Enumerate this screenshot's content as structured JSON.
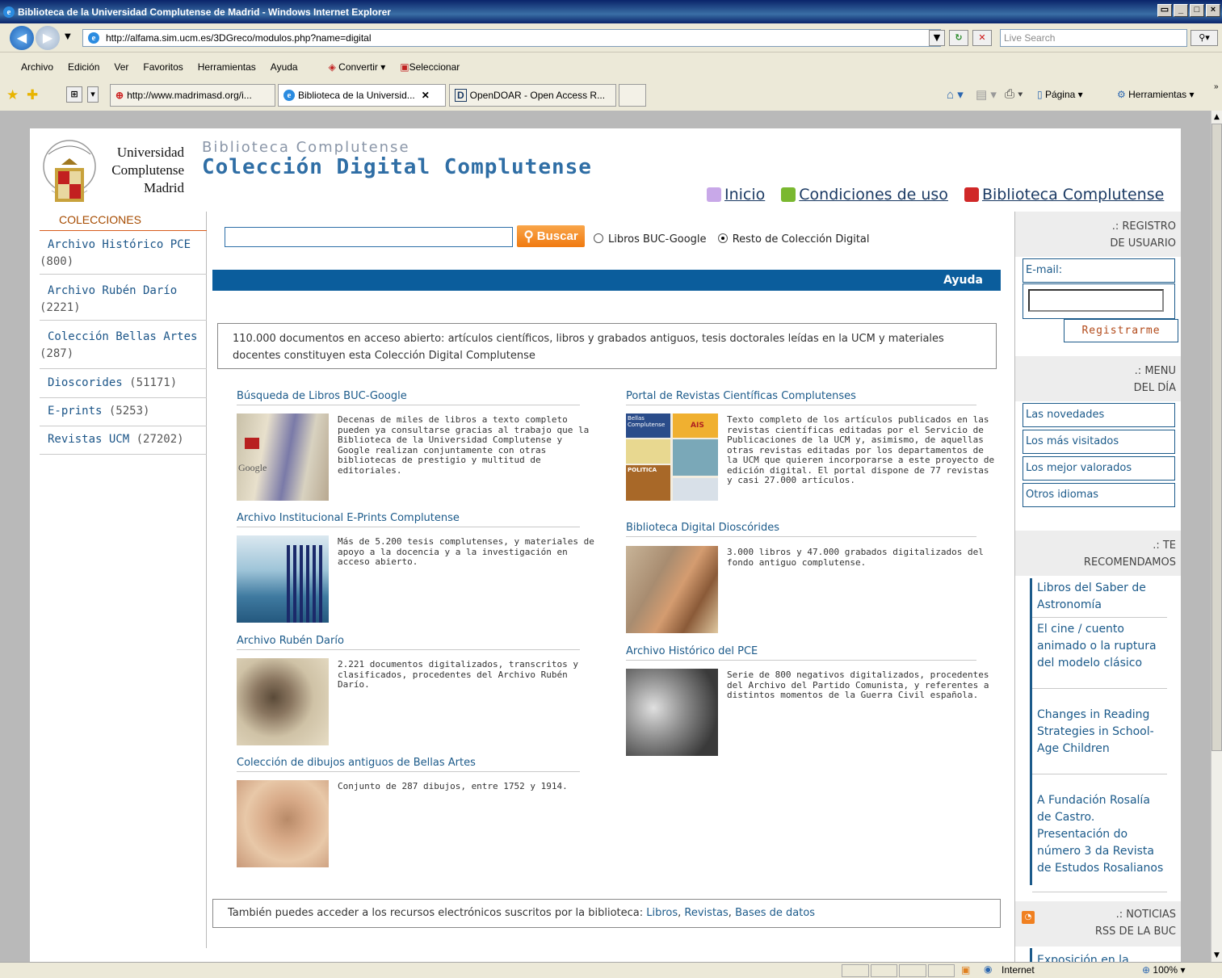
{
  "window": {
    "title": "Biblioteca de la Universidad Complutense de Madrid - Windows Internet Explorer"
  },
  "browser": {
    "url": "http://alfama.sim.ucm.es/3DGreco/modulos.php?name=digital",
    "search_placeholder": "Live Search",
    "menu": [
      "Archivo",
      "Edición",
      "Ver",
      "Favoritos",
      "Herramientas",
      "Ayuda"
    ],
    "convertir_label": "Convertir",
    "seleccionar_label": "Seleccionar",
    "tabs": [
      {
        "label": "http://www.madrimasd.org/i..."
      },
      {
        "label": "Biblioteca de la Universid..."
      },
      {
        "label": "OpenDOAR - Open Access R..."
      }
    ],
    "pagina_label": "Página",
    "herramientas_label": "Herramientas",
    "status": {
      "zone": "Internet",
      "zoom": "100%"
    }
  },
  "header": {
    "logo_lines": [
      "Universidad",
      "Complutense",
      "Madrid"
    ],
    "subtitle": "Biblioteca Complutense",
    "title": "Colección Digital Complutense",
    "links": [
      "Inicio",
      "Condiciones de uso",
      "Biblioteca Complutense"
    ]
  },
  "colecciones": {
    "heading": "COLECCIONES",
    "items": [
      {
        "name": "Archivo Histórico PCE",
        "count": "(800)"
      },
      {
        "name": "Archivo Rubén Darío",
        "count": "(2221)"
      },
      {
        "name": "Colección Bellas Artes",
        "count": "(287)"
      },
      {
        "name": "Dioscorides",
        "count": "(51171)"
      },
      {
        "name": "E-prints",
        "count": "(5253)"
      },
      {
        "name": "Revistas UCM",
        "count": "(27202)"
      }
    ]
  },
  "search": {
    "button": "Buscar",
    "option1": "Libros BUC-Google",
    "option2": "Resto de Colección Digital"
  },
  "help_label": "Ayuda",
  "intro": "110.000 documentos en acceso abierto: artículos científicos, libros y grabados antiguos, tesis doctorales leídas en la UCM y materiales docentes constituyen esta Colección Digital Complutense",
  "sections": [
    {
      "title": "Búsqueda de Libros BUC-Google",
      "desc": "Decenas de miles de libros a texto completo pueden ya consultarse gracias al trabajo que la Biblioteca de la Universidad Complutense y Google realizan conjuntamente con otras bibliotecas de prestigio y multitud de editoriales."
    },
    {
      "title": "Portal de Revistas Científicas Complutenses",
      "desc": "Texto completo de los artículos publicados en las revistas científicas editadas por el Servicio de Publicaciones de la UCM y, asimismo, de aquellas otras revistas editadas por los departamentos de la UCM que quieren incorporarse a este proyecto de edición digital. El portal dispone de 77 revistas y casi 27.000 artículos."
    },
    {
      "title": "Archivo Institucional E-Prints Complutense",
      "desc": "Más de 5.200 tesis complutenses, y materiales de apoyo a la docencia y a la investigación en acceso abierto."
    },
    {
      "title": "Biblioteca Digital Dioscórides",
      "desc": "3.000 libros y 47.000 grabados digitalizados del fondo antiguo complutense."
    },
    {
      "title": "Archivo Rubén Darío",
      "desc": "2.221 documentos digitalizados, transcritos y clasificados, procedentes del Archivo Rubén Darío."
    },
    {
      "title": "Archivo Histórico del PCE",
      "desc": "Serie de 800 negativos digitalizados, procedentes del Archivo del Partido Comunista, y referentes a distintos momentos de la Guerra Civil española."
    },
    {
      "title": "Colección de dibujos antiguos de Bellas Artes",
      "desc": "Conjunto de 287 dibujos, entre 1752 y 1914."
    }
  ],
  "thumb_texts": {
    "google": "Google",
    "revista1": "Bellas Complutense",
    "revista2": "AIS",
    "revista3": "POLITICA"
  },
  "footer": {
    "prefix": "También puedes acceder a los recursos electrónicos suscritos por la biblioteca: ",
    "libros": "Libros",
    "revistas": "Revistas",
    "bases": "Bases de datos",
    "sep": ", "
  },
  "sidebar": {
    "registro_l1": ".: REGISTRO",
    "registro_l2": "DE USUARIO",
    "email_label": "E-mail:",
    "register_button": "Registrarme",
    "menu_l1": ".: MENU",
    "menu_l2": "DEL DÍA",
    "menu_items": [
      "Las novedades",
      "Los más visitados",
      "Los mejor valorados",
      "Otros idiomas"
    ],
    "recom_l1": ".: TE",
    "recom_l2": "RECOMENDAMOS",
    "recommendations": [
      "Libros del Saber de Astronomía",
      "El cine / cuento animado o la ruptura del modelo clásico",
      "Changes in Reading Strategies in School-Age Children",
      "A Fundación Rosalía de Castro. Presentación do número 3 da Revista de Estudos Rosalianos"
    ],
    "news_l1": ".: NOTICIAS",
    "news_l2": "RSS DE LA BUC",
    "news_item": "Exposición en la"
  }
}
